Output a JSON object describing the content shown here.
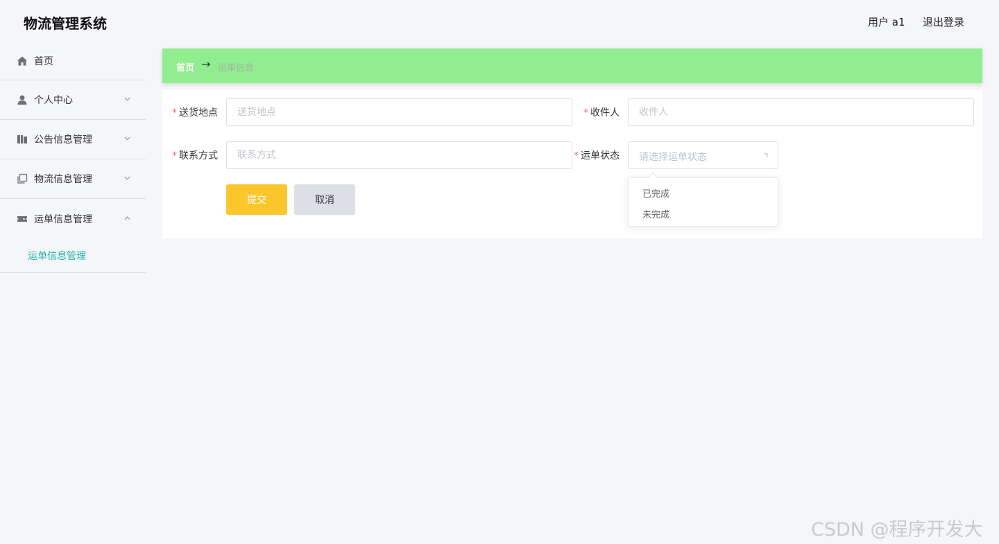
{
  "header": {
    "title": "物流管理系统",
    "user_label": "用户 a1",
    "logout_label": "退出登录"
  },
  "sidebar": {
    "items": [
      {
        "label": "首页",
        "icon": "home-icon",
        "has_arrow": false
      },
      {
        "label": "个人中心",
        "icon": "user-icon",
        "arrow": "chevron-down"
      },
      {
        "label": "公告信息管理",
        "icon": "book-icon",
        "arrow": "chevron-down"
      },
      {
        "label": "物流信息管理",
        "icon": "copy-icon",
        "arrow": "chevron-down"
      },
      {
        "label": "运单信息管理",
        "icon": "ticket-icon",
        "arrow": "chevron-up"
      }
    ],
    "submenu": {
      "label": "运单信息管理"
    }
  },
  "breadcrumb": {
    "home": "首页",
    "separator": "→",
    "current": "运单信息"
  },
  "form": {
    "delivery_location": {
      "label": "送货地点",
      "placeholder": "送货地点",
      "required": true
    },
    "recipient": {
      "label": "收件人",
      "placeholder": "收件人",
      "required": true
    },
    "contact": {
      "label": "联系方式",
      "placeholder": "联系方式",
      "required": true
    },
    "status": {
      "label": "运单状态",
      "placeholder": "请选择运单状态",
      "required": true,
      "options": [
        "已完成",
        "未完成"
      ]
    },
    "submit_label": "提交",
    "cancel_label": "取消"
  },
  "watermark": "CSDN @程序开发大师",
  "colors": {
    "breadcrumb_bg": "#90ee90",
    "submit_bg": "#fcc72d",
    "cancel_bg": "#dcdfe6",
    "active_submenu": "#20b2aa",
    "required_star": "#f56c6c"
  }
}
